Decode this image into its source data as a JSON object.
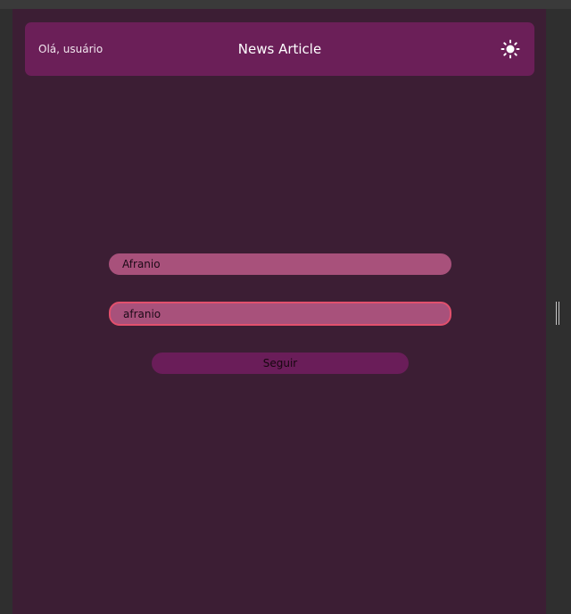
{
  "header": {
    "greeting": "Olá, usuário",
    "title": "News Article",
    "theme_toggle_icon": "sun-icon"
  },
  "form": {
    "name_value": "Afranio",
    "username_value": "afranio",
    "follow_label": "Seguir"
  },
  "colors": {
    "app_background": "#3c1e34",
    "header_background": "#6b1f58",
    "input_background": "#a8517b",
    "input_focus_border": "#e2506d",
    "button_background": "#6a1d59"
  }
}
